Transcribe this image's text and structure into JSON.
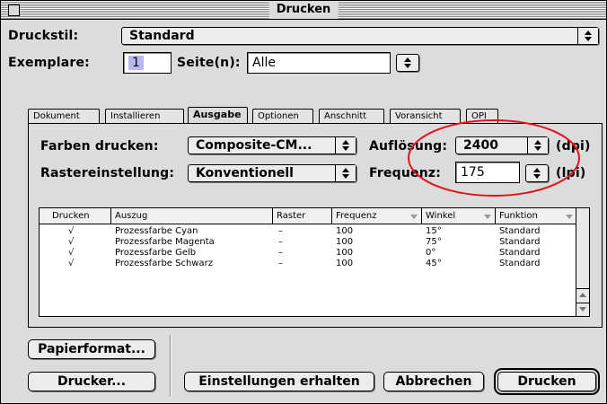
{
  "window": {
    "title": "Drucken"
  },
  "druckstil": {
    "label": "Druckstil:",
    "value": "Standard"
  },
  "exemplare": {
    "label": "Exemplare:",
    "value": "1"
  },
  "seiten": {
    "label": "Seite(n):",
    "value": "Alle"
  },
  "tabs": [
    {
      "label": "Dokument"
    },
    {
      "label": "Installieren"
    },
    {
      "label": "Ausgabe"
    },
    {
      "label": "Optionen"
    },
    {
      "label": "Anschnitt"
    },
    {
      "label": "Voransicht"
    },
    {
      "label": "OPI"
    }
  ],
  "active_tab": "Ausgabe",
  "ausgabe": {
    "farben_label": "Farben drucken:",
    "farben_value": "Composite-CM...",
    "raster_label": "Rastereinstellung:",
    "raster_value": "Konventionell",
    "aufloesung_label": "Auflösung:",
    "aufloesung_value": "2400",
    "aufloesung_unit": "(dpi)",
    "frequenz_label": "Frequenz:",
    "frequenz_value": "175",
    "frequenz_unit": "(lpi)"
  },
  "table": {
    "columns": [
      "Drucken",
      "Auszug",
      "Raster",
      "Frequenz",
      "Winkel",
      "Funktion"
    ],
    "rows": [
      {
        "drucken": "√",
        "auszug": "Prozessfarbe Cyan",
        "raster": "–",
        "frequenz": "100",
        "winkel": "15°",
        "funktion": "Standard"
      },
      {
        "drucken": "√",
        "auszug": "Prozessfarbe Magenta",
        "raster": "–",
        "frequenz": "100",
        "winkel": "75°",
        "funktion": "Standard"
      },
      {
        "drucken": "√",
        "auszug": "Prozessfarbe Gelb",
        "raster": "–",
        "frequenz": "100",
        "winkel": "0°",
        "funktion": "Standard"
      },
      {
        "drucken": "√",
        "auszug": "Prozessfarbe Schwarz",
        "raster": "–",
        "frequenz": "100",
        "winkel": "45°",
        "funktion": "Standard"
      }
    ]
  },
  "buttons": {
    "papierformat": "Papierformat...",
    "drucker": "Drucker...",
    "einstellungen": "Einstellungen erhalten",
    "abbrechen": "Abbrechen",
    "drucken": "Drucken"
  },
  "colors": {
    "annotation_circle": "#e0141e",
    "selection_highlight": "#b8b8f0",
    "dialog_background": "#dcdcdc"
  }
}
